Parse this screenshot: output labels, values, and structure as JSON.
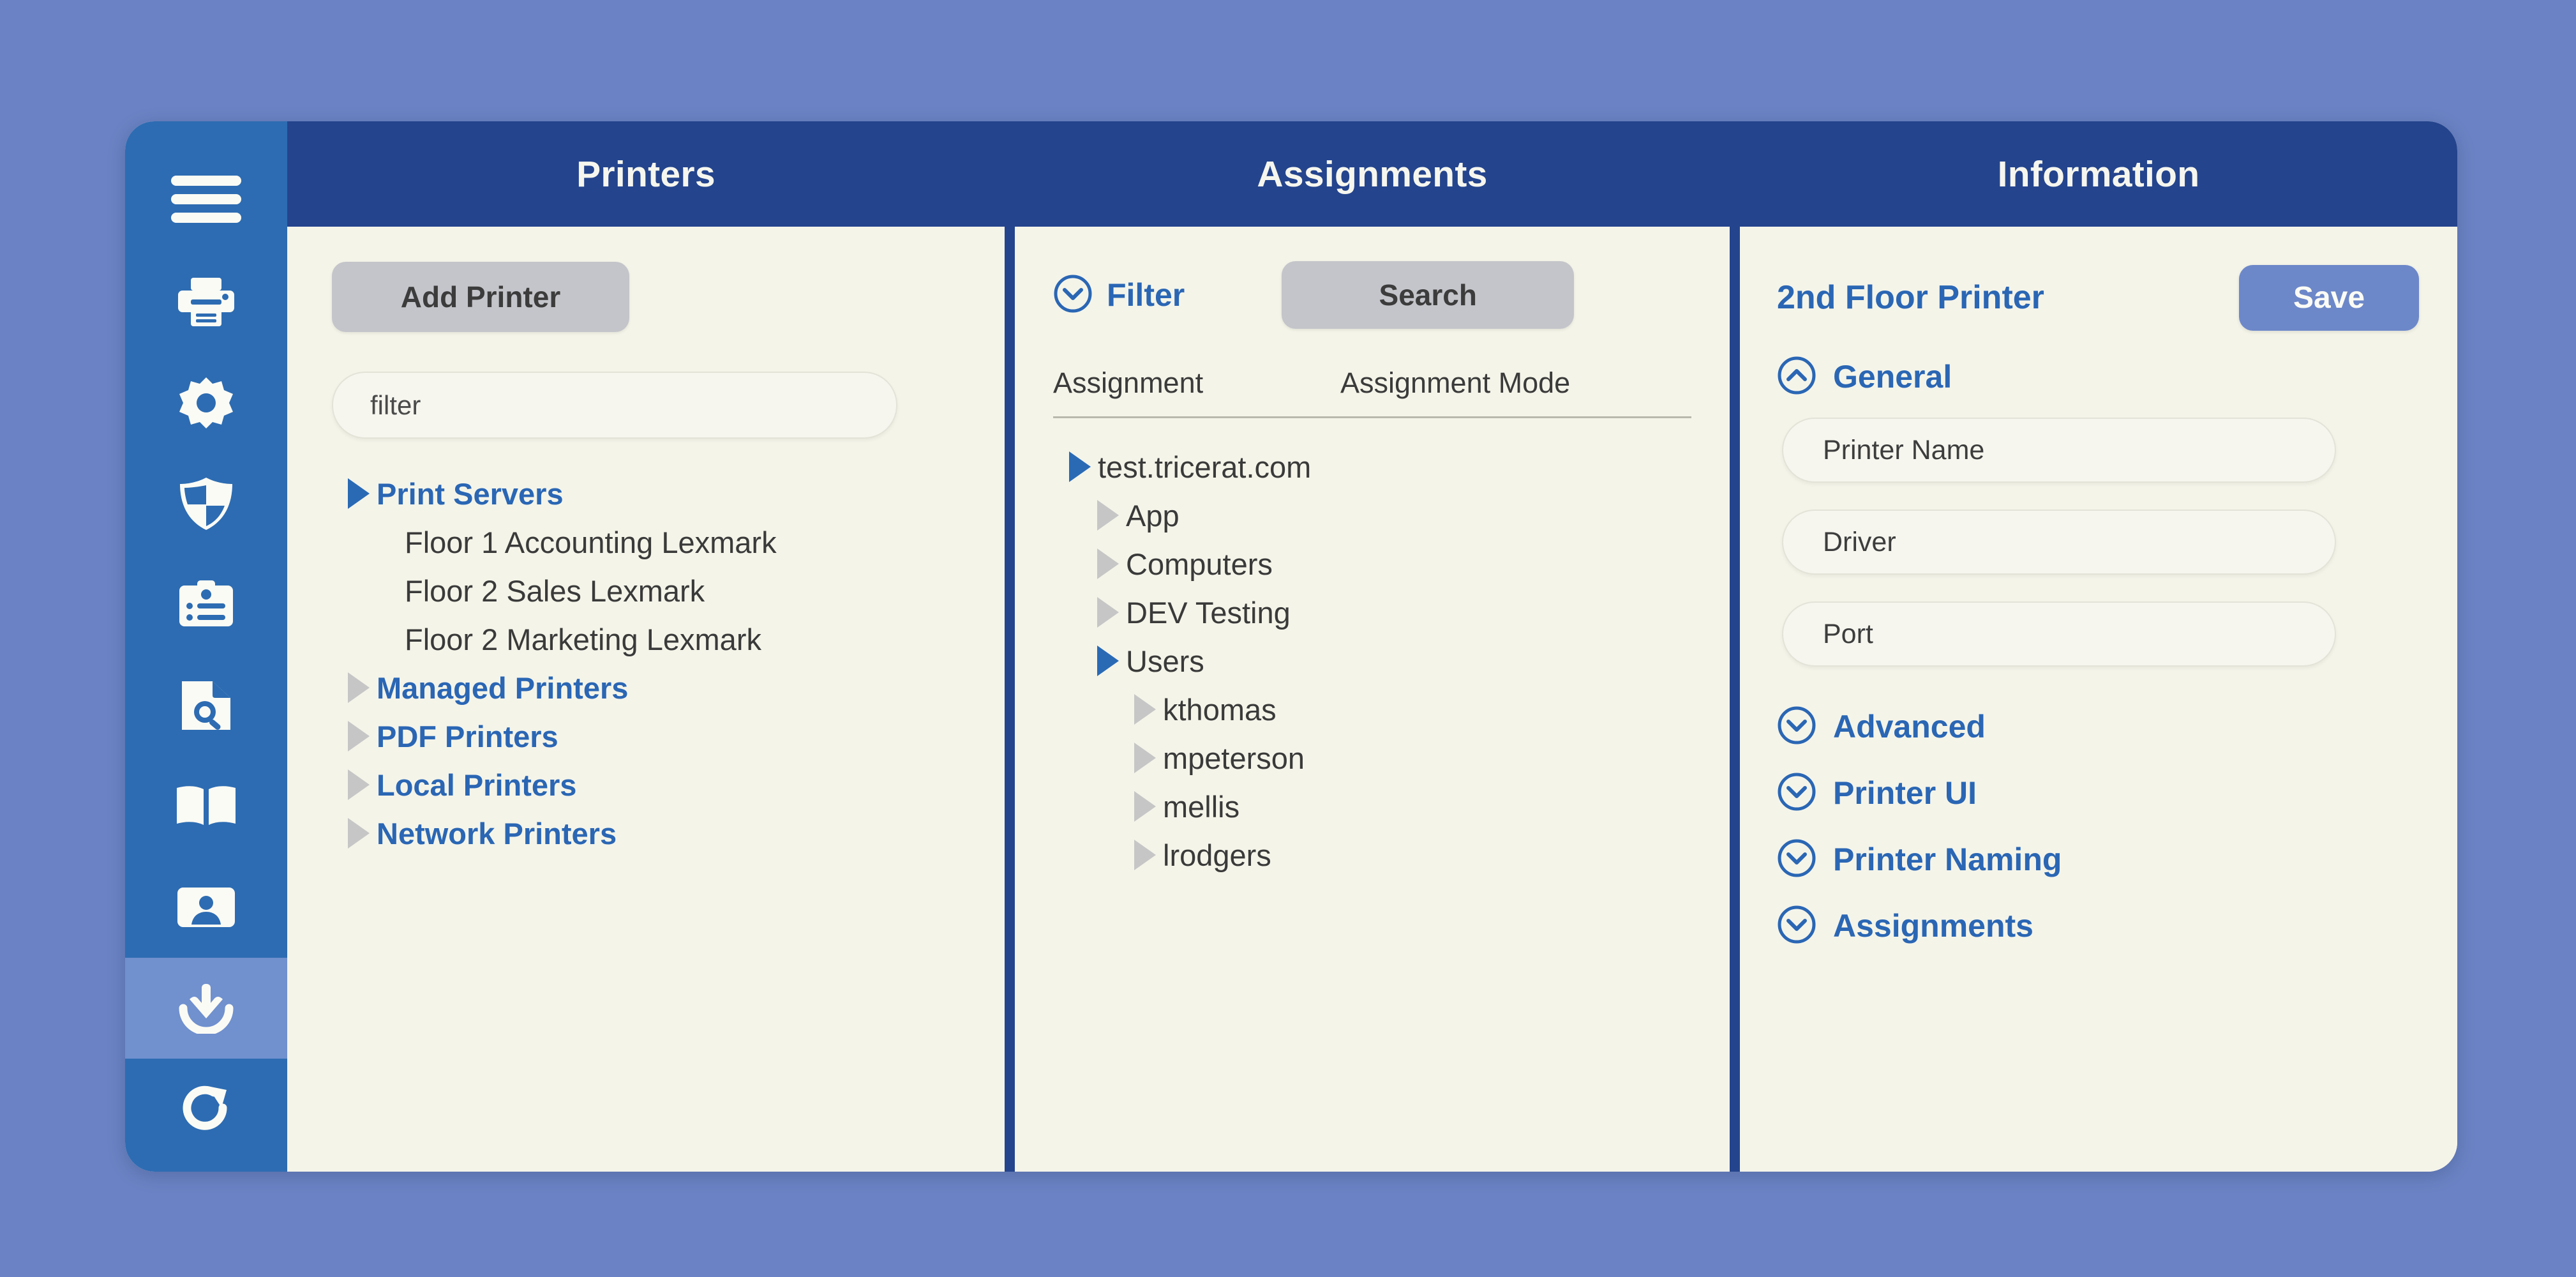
{
  "sidebar": {
    "items": [
      {
        "icon": "hamburger-menu-icon",
        "name": "menu-toggle"
      },
      {
        "icon": "printer-icon",
        "name": "printers-nav"
      },
      {
        "icon": "gear-icon",
        "name": "settings-nav"
      },
      {
        "icon": "shield-icon",
        "name": "security-nav"
      },
      {
        "icon": "clipboard-list-icon",
        "name": "profiles-nav"
      },
      {
        "icon": "document-search-icon",
        "name": "reports-nav"
      },
      {
        "icon": "book-icon",
        "name": "documentation-nav"
      },
      {
        "icon": "id-card-icon",
        "name": "users-nav"
      },
      {
        "icon": "download-icon",
        "name": "downloads-nav",
        "active": true
      },
      {
        "icon": "refresh-icon",
        "name": "refresh-nav"
      }
    ]
  },
  "columns": {
    "printers": {
      "title": "Printers",
      "add_button": "Add Printer",
      "filter_value": "filter",
      "tree": [
        {
          "label": "Print Servers",
          "kind": "category",
          "state": "open",
          "indent": 1
        },
        {
          "label": "Floor 1 Accounting Lexmark",
          "kind": "leaf",
          "state": "none",
          "indent": 2
        },
        {
          "label": "Floor 2 Sales Lexmark",
          "kind": "leaf",
          "state": "none",
          "indent": 2
        },
        {
          "label": "Floor 2 Marketing Lexmark",
          "kind": "leaf",
          "state": "none",
          "indent": 2
        },
        {
          "label": "Managed Printers",
          "kind": "category",
          "state": "closed",
          "indent": 1
        },
        {
          "label": "PDF Printers",
          "kind": "category",
          "state": "closed",
          "indent": 1
        },
        {
          "label": "Local Printers",
          "kind": "category",
          "state": "closed",
          "indent": 1
        },
        {
          "label": "Network Printers",
          "kind": "category",
          "state": "closed",
          "indent": 1
        }
      ]
    },
    "assignments": {
      "title": "Assignments",
      "filter_label": "Filter",
      "search_button": "Search",
      "col_assignment": "Assignment",
      "col_assignment_mode": "Assignment Mode",
      "tree": [
        {
          "label": "test.tricerat.com",
          "state": "open",
          "indent": 1
        },
        {
          "label": "App",
          "state": "closed",
          "indent": 2
        },
        {
          "label": "Computers",
          "state": "closed",
          "indent": 2
        },
        {
          "label": "DEV Testing",
          "state": "closed",
          "indent": 2
        },
        {
          "label": "Users",
          "state": "open",
          "indent": 2
        },
        {
          "label": "kthomas",
          "state": "closed",
          "indent": 3
        },
        {
          "label": "mpeterson",
          "state": "closed",
          "indent": 3
        },
        {
          "label": "mellis",
          "state": "closed",
          "indent": 3
        },
        {
          "label": "lrodgers",
          "state": "closed",
          "indent": 3
        }
      ]
    },
    "information": {
      "title": "Information",
      "printer_title": "2nd Floor Printer",
      "save_button": "Save",
      "general_section": "General",
      "fields": [
        {
          "label": "Printer Name",
          "name": "printer-name-field"
        },
        {
          "label": "Driver",
          "name": "driver-field"
        },
        {
          "label": "Port",
          "name": "port-field"
        }
      ],
      "collapsed_sections": [
        {
          "label": "Advanced"
        },
        {
          "label": "Printer UI"
        },
        {
          "label": "Printer Naming"
        },
        {
          "label": "Assignments"
        }
      ]
    }
  },
  "colors": {
    "page_background": "#6b83c4",
    "sidebar": "#2d6cb2",
    "sidebar_active": "#7090ce",
    "header_bar": "#24448d",
    "panel_background": "#f4f4e9",
    "accent_blue": "#2a66b4",
    "button_gray": "#c4c5ca",
    "save_blue": "#6d88c9"
  }
}
